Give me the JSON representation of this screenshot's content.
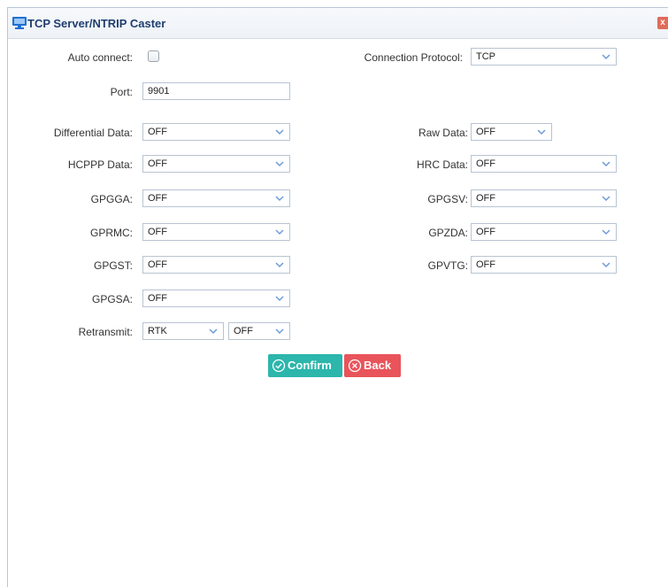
{
  "dialog": {
    "title": "TCP Server/NTRIP Caster",
    "close_label": "x"
  },
  "form": {
    "auto_connect_label": "Auto connect:",
    "auto_connect_checked": false,
    "connection_protocol_label": "Connection Protocol:",
    "connection_protocol_value": "TCP",
    "port_label": "Port:",
    "port_value": "9901",
    "differential_data_label": "Differential Data:",
    "differential_data_value": "OFF",
    "raw_data_label": "Raw Data:",
    "raw_data_value": "OFF",
    "hcppp_data_label": "HCPPP Data:",
    "hcppp_data_value": "OFF",
    "hrc_data_label": "HRC Data:",
    "hrc_data_value": "OFF",
    "gpgga_label": "GPGGA:",
    "gpgga_value": "OFF",
    "gpgsv_label": "GPGSV:",
    "gpgsv_value": "OFF",
    "gprmc_label": "GPRMC:",
    "gprmc_value": "OFF",
    "gpzda_label": "GPZDA:",
    "gpzda_value": "OFF",
    "gpgst_label": "GPGST:",
    "gpgst_value": "OFF",
    "gpvtg_label": "GPVTG:",
    "gpvtg_value": "OFF",
    "gpgsa_label": "GPGSA:",
    "gpgsa_value": "OFF",
    "retransmit_label": "Retransmit:",
    "retransmit_type_value": "RTK",
    "retransmit_state_value": "OFF"
  },
  "buttons": {
    "confirm_label": "Confirm",
    "back_label": "Back"
  },
  "colors": {
    "confirm": "#2cb6ac",
    "back": "#e9545b",
    "title": "#1f3e6e"
  }
}
